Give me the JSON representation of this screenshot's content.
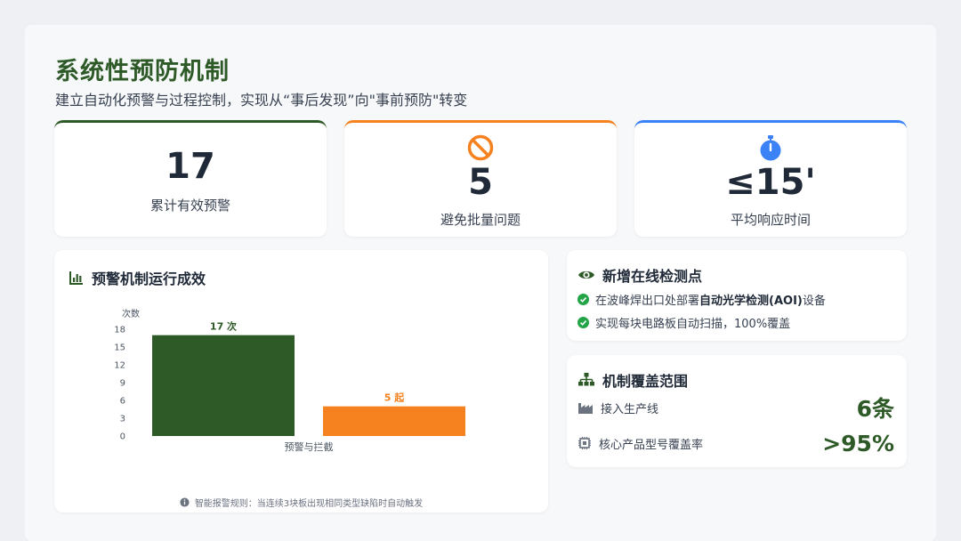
{
  "header": {
    "title": "系统性预防机制",
    "subtitle": "建立自动化预警与过程控制，实现从“事后发现”向\"事前预防\"转变"
  },
  "stats": [
    {
      "value": "17",
      "label": "累计有效预警",
      "accent": "#2d5a27"
    },
    {
      "value": "5",
      "label": "避免批量问题",
      "accent": "#f5821f",
      "icon": "ban-icon"
    },
    {
      "value": "≤15'",
      "label": "平均响应时间",
      "accent": "#3b82f6",
      "icon": "stopwatch-icon"
    }
  ],
  "chart_panel": {
    "heading": "预警机制运行成效",
    "icon": "bar-chart-icon",
    "note": "智能报警规则：当连续3块板出现相同类型缺陷时自动触发"
  },
  "chart_data": {
    "type": "bar",
    "ylabel": "次数",
    "ylim": [
      0,
      18
    ],
    "yticks": [
      0,
      3,
      6,
      9,
      12,
      15,
      18
    ],
    "categories": [
      "预警与拦截"
    ],
    "series": [
      {
        "values": [
          17
        ],
        "data_label": "17 次",
        "color": "#2d5a27"
      },
      {
        "values": [
          5
        ],
        "data_label": "5 起",
        "color": "#f5821f"
      }
    ],
    "grid": false,
    "legend": "none"
  },
  "detection": {
    "heading": "新增在线检测点",
    "icon": "eye-icon",
    "items": [
      {
        "prefix": "在波峰焊出口处部署",
        "bold": "自动光学检测(AOI)",
        "suffix": "设备"
      },
      {
        "prefix": "实现每块电路板自动扫描，100%覆盖",
        "bold": "",
        "suffix": ""
      }
    ]
  },
  "coverage": {
    "heading": "机制覆盖范围",
    "icon": "sitemap-icon",
    "rows": [
      {
        "label": "接入生产线",
        "value": "6条",
        "icon": "factory-icon"
      },
      {
        "label": "核心产品型号覆盖率",
        "value": ">95%",
        "icon": "chip-icon"
      }
    ]
  },
  "colors": {
    "green": "#2d5a27",
    "orange": "#f5821f",
    "blue": "#3b82f6",
    "check": "#22a447"
  }
}
